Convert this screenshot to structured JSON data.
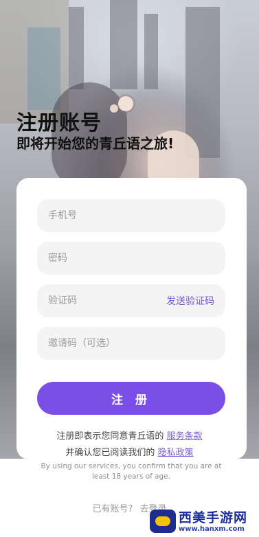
{
  "header": {
    "title": "注册账号",
    "subtitle": "即将开始您的青丘语之旅!"
  },
  "form": {
    "phone_placeholder": "手机号",
    "password_placeholder": "密码",
    "code_placeholder": "验证码",
    "send_code_label": "发送验证码",
    "invite_placeholder": "邀请码（可选）",
    "register_label": "注 册"
  },
  "agreement": {
    "line1_prefix": "注册即表示您同意青丘语的",
    "terms_link": "服务条款",
    "line2_prefix": "并确认您已阅读我们的",
    "privacy_link": "隐私政策",
    "english_note": "By using our services, you confirm that you are at least 18 years of age."
  },
  "footer": {
    "have_account": "已有账号?",
    "go_login": "去登录"
  },
  "watermark": {
    "brand": "西美手游网",
    "url": "www.hanxm.com"
  },
  "colors": {
    "accent": "#7a4fe8",
    "link": "#7b5ad8",
    "field_bg": "#f4f4f5"
  }
}
